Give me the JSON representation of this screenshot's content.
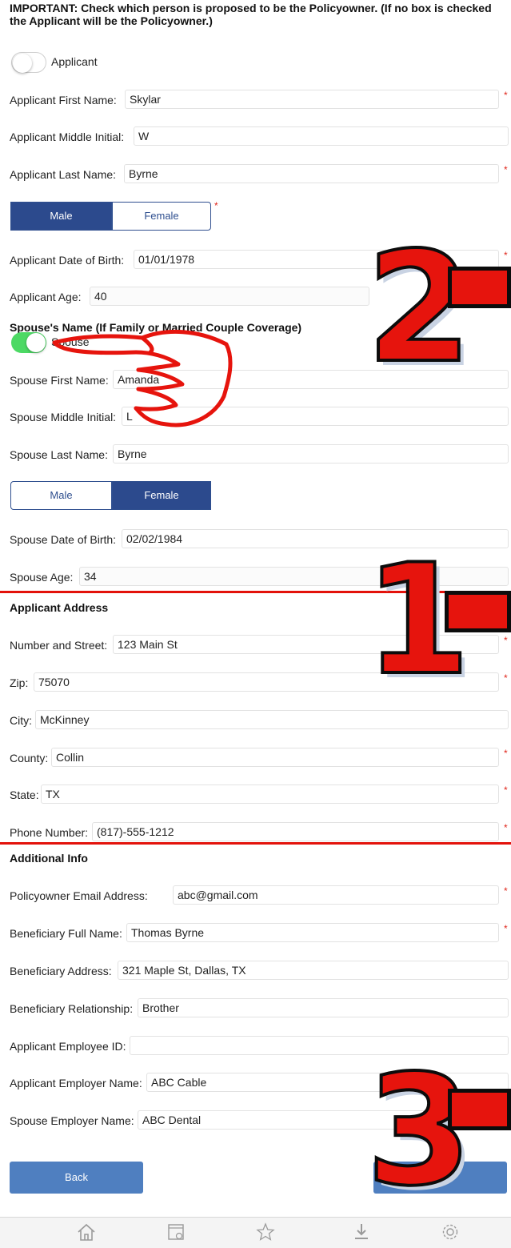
{
  "notice": "IMPORTANT: Check which person is proposed to be the Policyowner. (If no box is checked the Applicant will be the Policyowner.)",
  "applicant_toggle": {
    "label": "Applicant",
    "checked": false
  },
  "applicant": {
    "first_name_label": "Applicant First Name:",
    "first_name": "Skylar",
    "middle_initial_label": "Applicant Middle Initial:",
    "middle_initial": "W",
    "last_name_label": "Applicant Last Name:",
    "last_name": "Byrne",
    "gender": {
      "male": "Male",
      "female": "Female",
      "selected": "Male"
    },
    "dob_label": "Applicant Date of Birth:",
    "dob": "01/01/1978",
    "age_label": "Applicant Age:",
    "age": "40"
  },
  "spouse_heading": "Spouse's Name (If Family or Married Couple Coverage)",
  "spouse_toggle": {
    "label": "Spouse",
    "checked": true
  },
  "spouse": {
    "first_name_label": "Spouse First Name:",
    "first_name": "Amanda",
    "middle_initial_label": "Spouse Middle Initial:",
    "middle_initial": "L",
    "last_name_label": "Spouse Last Name:",
    "last_name": "Byrne",
    "gender": {
      "male": "Male",
      "female": "Female",
      "selected": "Female"
    },
    "dob_label": "Spouse Date of Birth:",
    "dob": "02/02/1984",
    "age_label": "Spouse Age:",
    "age": "34"
  },
  "address": {
    "title": "Applicant Address",
    "street_label": "Number and Street:",
    "street": "123 Main St",
    "zip_label": "Zip:",
    "zip": "75070",
    "city_label": "City:",
    "city": "McKinney",
    "county_label": "County:",
    "county": "Collin",
    "state_label": "State:",
    "state": "TX",
    "phone_label": "Phone Number:",
    "phone": "(817)-555-1212"
  },
  "additional": {
    "title": "Additional Info",
    "email_label": "Policyowner Email Address:",
    "email": "abc@gmail.com",
    "beneficiary_name_label": "Beneficiary Full Name:",
    "beneficiary_name": "Thomas Byrne",
    "beneficiary_address_label": "Beneficiary Address:",
    "beneficiary_address": "321 Maple St, Dallas, TX",
    "beneficiary_relationship_label": "Beneficiary Relationship:",
    "beneficiary_relationship": "Brother",
    "employee_id_label": "Applicant Employee ID:",
    "employee_id": "",
    "employer_name_label": "Applicant Employer Name:",
    "employer_name": "ABC Cable",
    "spouse_employer_label": "Spouse Employer Name:",
    "spouse_employer": "ABC Dental"
  },
  "required_mark": "*",
  "buttons": {
    "back": "Back",
    "next": "Next"
  },
  "annotations": {
    "one": "1",
    "two": "2",
    "three": "3"
  },
  "tabbar": {
    "icons": [
      "home-icon",
      "calendar-icon",
      "star-icon",
      "download-icon",
      "gear-icon"
    ]
  },
  "colors": {
    "accent": "#2c4a8d",
    "button": "#4f7fc0",
    "toggle_on": "#4cd964",
    "required": "#e0261b",
    "annotation_red": "#e6140d"
  }
}
